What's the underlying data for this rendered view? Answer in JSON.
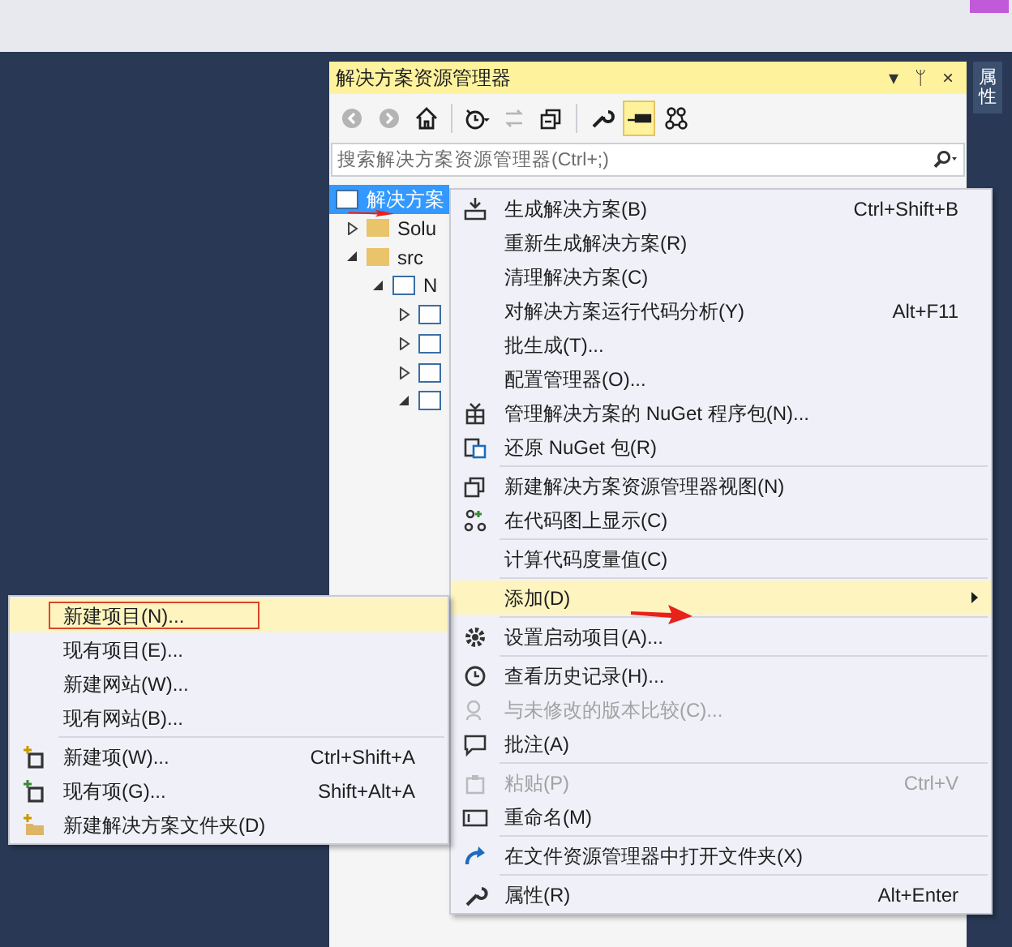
{
  "side_tab": {
    "label": "属性"
  },
  "panel": {
    "title": "解决方案资源管理器",
    "title_controls": [
      "▾",
      "ᛘ",
      "×"
    ]
  },
  "toolbar": [
    {
      "disabled": true,
      "selected": false
    },
    {
      "disabled": true,
      "selected": false
    },
    {
      "disabled": false,
      "selected": false
    },
    {
      "disabled": false,
      "selected": false
    },
    {
      "disabled": true,
      "selected": false
    },
    {
      "disabled": false,
      "selected": false
    },
    {
      "disabled": false,
      "selected": false
    },
    {
      "disabled": false,
      "selected": true
    },
    {
      "disabled": false,
      "selected": false
    }
  ],
  "search": {
    "placeholder": "搜索解决方案资源管理器(Ctrl+;)"
  },
  "tree": [
    {
      "label": "解决方案",
      "selected": true,
      "children": [
        {
          "label": "Solu",
          "selected": false,
          "expanded": false
        },
        {
          "label": "src",
          "selected": false,
          "expanded": true,
          "children": [
            {
              "label": "N",
              "selected": false,
              "expanded": true,
              "children": [
                {
                  "selected": false,
                  "expanded": false
                },
                {
                  "selected": false,
                  "expanded": false
                },
                {
                  "selected": false,
                  "expanded": false
                },
                {
                  "selected": false,
                  "expanded": true
                }
              ]
            }
          ]
        }
      ]
    }
  ],
  "context_menu": [
    {
      "kind": "item",
      "label": "生成解决方案(B)",
      "shortcut": "Ctrl+Shift+B",
      "disabled": false,
      "selected": false
    },
    {
      "kind": "item",
      "label": "重新生成解决方案(R)",
      "disabled": false,
      "selected": false
    },
    {
      "kind": "item",
      "label": "清理解决方案(C)",
      "disabled": false,
      "selected": false
    },
    {
      "kind": "item",
      "label": "对解决方案运行代码分析(Y)",
      "shortcut": "Alt+F11",
      "disabled": false,
      "selected": false
    },
    {
      "kind": "item",
      "label": "批生成(T)...",
      "disabled": false,
      "selected": false
    },
    {
      "kind": "item",
      "label": "配置管理器(O)...",
      "disabled": false,
      "selected": false
    },
    {
      "kind": "item",
      "label": "管理解决方案的 NuGet 程序包(N)...",
      "disabled": false,
      "selected": false
    },
    {
      "kind": "item",
      "label": "还原 NuGet 包(R)",
      "disabled": false,
      "selected": false
    },
    {
      "kind": "separator"
    },
    {
      "kind": "item",
      "label": "新建解决方案资源管理器视图(N)",
      "disabled": false,
      "selected": false
    },
    {
      "kind": "item",
      "label": "在代码图上显示(C)",
      "disabled": false,
      "selected": false
    },
    {
      "kind": "separator"
    },
    {
      "kind": "item",
      "label": "计算代码度量值(C)",
      "disabled": false,
      "selected": false
    },
    {
      "kind": "separator"
    },
    {
      "kind": "submenu",
      "label": "添加(D)",
      "disabled": false,
      "selected": true
    },
    {
      "kind": "separator"
    },
    {
      "kind": "item",
      "label": "设置启动项目(A)...",
      "disabled": false,
      "selected": false
    },
    {
      "kind": "separator"
    },
    {
      "kind": "item",
      "label": "查看历史记录(H)...",
      "disabled": false,
      "selected": false
    },
    {
      "kind": "item",
      "label": "与未修改的版本比较(C)...",
      "disabled": true,
      "selected": false
    },
    {
      "kind": "item",
      "label": "批注(A)",
      "disabled": false,
      "selected": false
    },
    {
      "kind": "separator"
    },
    {
      "kind": "item",
      "label": "粘贴(P)",
      "shortcut": "Ctrl+V",
      "disabled": true,
      "selected": false
    },
    {
      "kind": "item",
      "label": "重命名(M)",
      "disabled": false,
      "selected": false
    },
    {
      "kind": "separator"
    },
    {
      "kind": "item",
      "label": "在文件资源管理器中打开文件夹(X)",
      "disabled": false,
      "selected": false
    },
    {
      "kind": "separator"
    },
    {
      "kind": "item",
      "label": "属性(R)",
      "shortcut": "Alt+Enter",
      "disabled": false,
      "selected": false
    }
  ],
  "submenu": [
    {
      "kind": "item",
      "label": "新建项目(N)...",
      "selected": true,
      "outlined": true
    },
    {
      "kind": "item",
      "label": "现有项目(E)...",
      "selected": false,
      "outlined": false
    },
    {
      "kind": "item",
      "label": "新建网站(W)...",
      "selected": false,
      "outlined": false
    },
    {
      "kind": "item",
      "label": "现有网站(B)...",
      "selected": false,
      "outlined": false
    },
    {
      "kind": "separator"
    },
    {
      "kind": "item",
      "label": "新建项(W)...",
      "shortcut": "Ctrl+Shift+A",
      "selected": false,
      "outlined": false
    },
    {
      "kind": "item",
      "label": "现有项(G)...",
      "shortcut": "Shift+Alt+A",
      "selected": false,
      "outlined": false
    },
    {
      "kind": "item",
      "label": "新建解决方案文件夹(D)",
      "selected": false,
      "outlined": false
    }
  ]
}
